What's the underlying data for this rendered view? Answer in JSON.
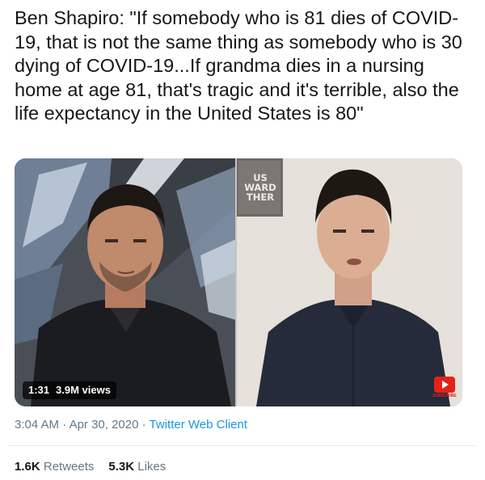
{
  "tweet": {
    "text": "Ben Shapiro: \"If somebody who is 81 dies of COVID-19, that is not the same thing as somebody who is 30 dying of COVID-19...If grandma dies in a nursing home at age 81, that's tragic and it's terrible, also the life expectancy in the United States is 80\""
  },
  "video": {
    "duration": "1:31",
    "views": "3.9M views",
    "sign_text": "US\nWARD\nTHER",
    "logo_text": "SUBSCRIBE"
  },
  "meta": {
    "time": "3:04 AM",
    "separator": " · ",
    "date": "Apr 30, 2020",
    "client": "Twitter Web Client"
  },
  "stats": {
    "retweets_count": "1.6K",
    "retweets_label": "Retweets",
    "likes_count": "5.3K",
    "likes_label": "Likes"
  }
}
